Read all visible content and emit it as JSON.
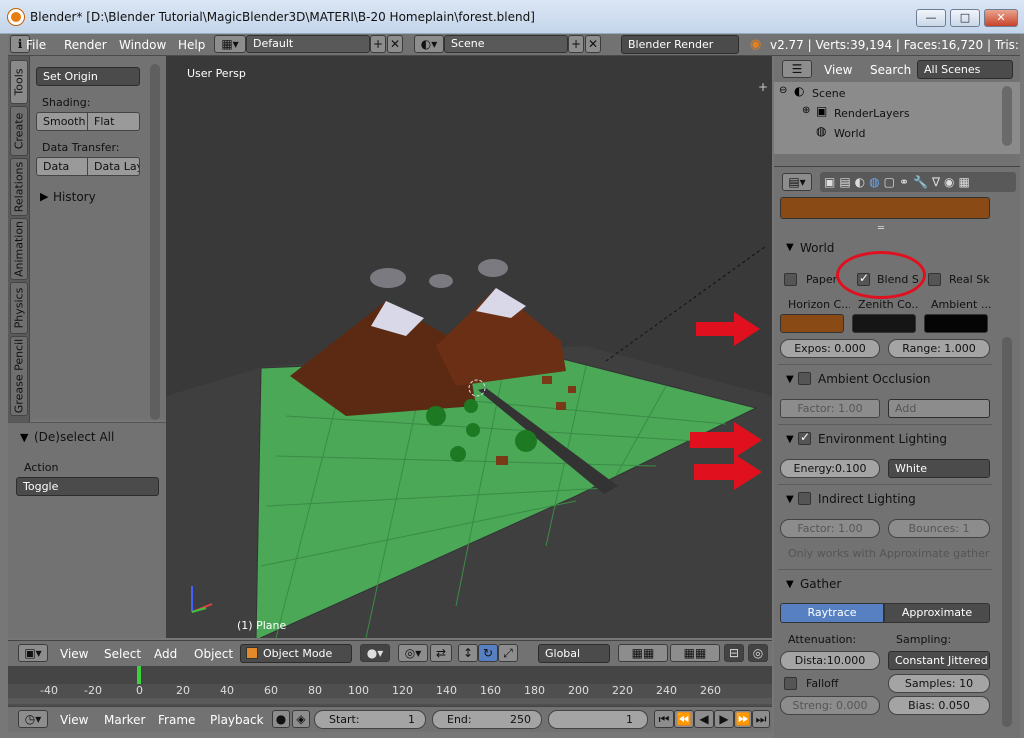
{
  "window": {
    "title": "Blender* [D:\\Blender Tutorial\\MagicBlender3D\\MATERI\\B-20 Homeplain\\forest.blend]",
    "min": "—",
    "max": "□",
    "close": "✕"
  },
  "infobar": {
    "menus": [
      "File",
      "Render",
      "Window",
      "Help"
    ],
    "layout": "Default",
    "scene": "Scene",
    "engine": "Blender Render",
    "stats": "v2.77 | Verts:39,194 | Faces:16,720 | Tris:32,4"
  },
  "tools": {
    "tabs": [
      "Tools",
      "Create",
      "Relations",
      "Animation",
      "Physics",
      "Grease Pencil"
    ],
    "set_origin": "Set Origin",
    "shading_label": "Shading:",
    "smooth": "Smooth",
    "flat": "Flat",
    "data_transfer_label": "Data Transfer:",
    "data": "Data",
    "data_lay": "Data Lay",
    "history": "History"
  },
  "operator": {
    "title": "(De)select All",
    "action_label": "Action",
    "action_value": "Toggle"
  },
  "viewport": {
    "persp": "User Persp",
    "object": "(1) Plane"
  },
  "outliner": {
    "view": "View",
    "search": "Search",
    "filter": "All Scenes",
    "items": [
      "Scene",
      "RenderLayers",
      "World"
    ]
  },
  "world": {
    "section": "World",
    "paper": "Paper",
    "blend": "Blend S",
    "real": "Real Sk",
    "horizon": "Horizon C...",
    "zenith": "Zenith Co...",
    "ambient": "Ambient ...",
    "horizon_color": "#8a4a15",
    "zenith_color": "#151515",
    "ambient_color": "#050505",
    "top_swatch": "#8a4a15",
    "expos": "Expos: 0.000",
    "range": "Range: 1.000"
  },
  "ao": {
    "section": "Ambient Occlusion",
    "factor": "Factor:     1.00",
    "add": "Add"
  },
  "env": {
    "section": "Environment Lighting",
    "energy": "Energy:0.100",
    "white": "White"
  },
  "indirect": {
    "section": "Indirect Lighting",
    "factor": "Factor:     1.00",
    "bounces": "Bounces:     1",
    "note": "Only works with Approximate gather ..."
  },
  "gather": {
    "section": "Gather",
    "raytrace": "Raytrace",
    "approx": "Approximate",
    "attenuation": "Attenuation:",
    "sampling": "Sampling:",
    "dista": "Dista:10.000",
    "constant": "Constant Jittered",
    "falloff": "Falloff",
    "samples": "Samples:   10",
    "streng": "Streng: 0.000",
    "bias": "Bias:     0.050"
  },
  "vheader": {
    "view": "View",
    "select": "Select",
    "add": "Add",
    "object": "Object",
    "mode": "Object Mode",
    "orientation": "Global"
  },
  "timeline": {
    "ticks": [
      "-40",
      "-20",
      "0",
      "20",
      "40",
      "60",
      "80",
      "100",
      "120",
      "140",
      "160",
      "180",
      "200",
      "220",
      "240",
      "260"
    ]
  },
  "theader": {
    "view": "View",
    "marker": "Marker",
    "frame": "Frame",
    "playback": "Playback",
    "start_label": "Start:",
    "start": "1",
    "end_label": "End:",
    "end": "250",
    "current": "1"
  }
}
